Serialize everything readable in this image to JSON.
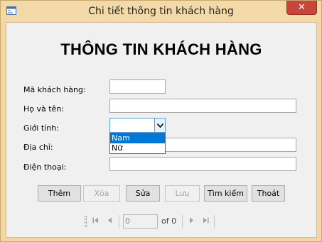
{
  "window": {
    "title": "Chi tiết thông tin khách hàng",
    "close_glyph": "✕"
  },
  "form": {
    "heading": "THÔNG TIN KHÁCH HÀNG",
    "fields": {
      "customer_id": {
        "label": "Mã khách hàng:",
        "value": ""
      },
      "full_name": {
        "label": "Họ và tên:",
        "value": ""
      },
      "gender": {
        "label": "Giới tính:",
        "value": "",
        "options": [
          "Nam",
          "Nữ"
        ],
        "highlighted_option": "Nam"
      },
      "address": {
        "label": "Địa chỉ:",
        "value": ""
      },
      "phone": {
        "label": "Điện thoại:",
        "value": ""
      }
    }
  },
  "buttons": {
    "add": "Thêm",
    "delete": "Xóa",
    "edit": "Sửa",
    "save": "Lưu",
    "search": "Tìm kiếm",
    "exit": "Thoát"
  },
  "navigator": {
    "position": "0",
    "count_text": "of 0"
  },
  "icons": {
    "app": "form-window-icon",
    "dropdown": "chevron-down-icon",
    "first": "move-first-icon",
    "prev": "move-previous-icon",
    "next": "move-next-icon",
    "last": "move-last-icon"
  },
  "colors": {
    "title_bar": "#f3d9a8",
    "close_button": "#c7463c",
    "selection": "#0078d7",
    "focus_border": "#569de5"
  }
}
